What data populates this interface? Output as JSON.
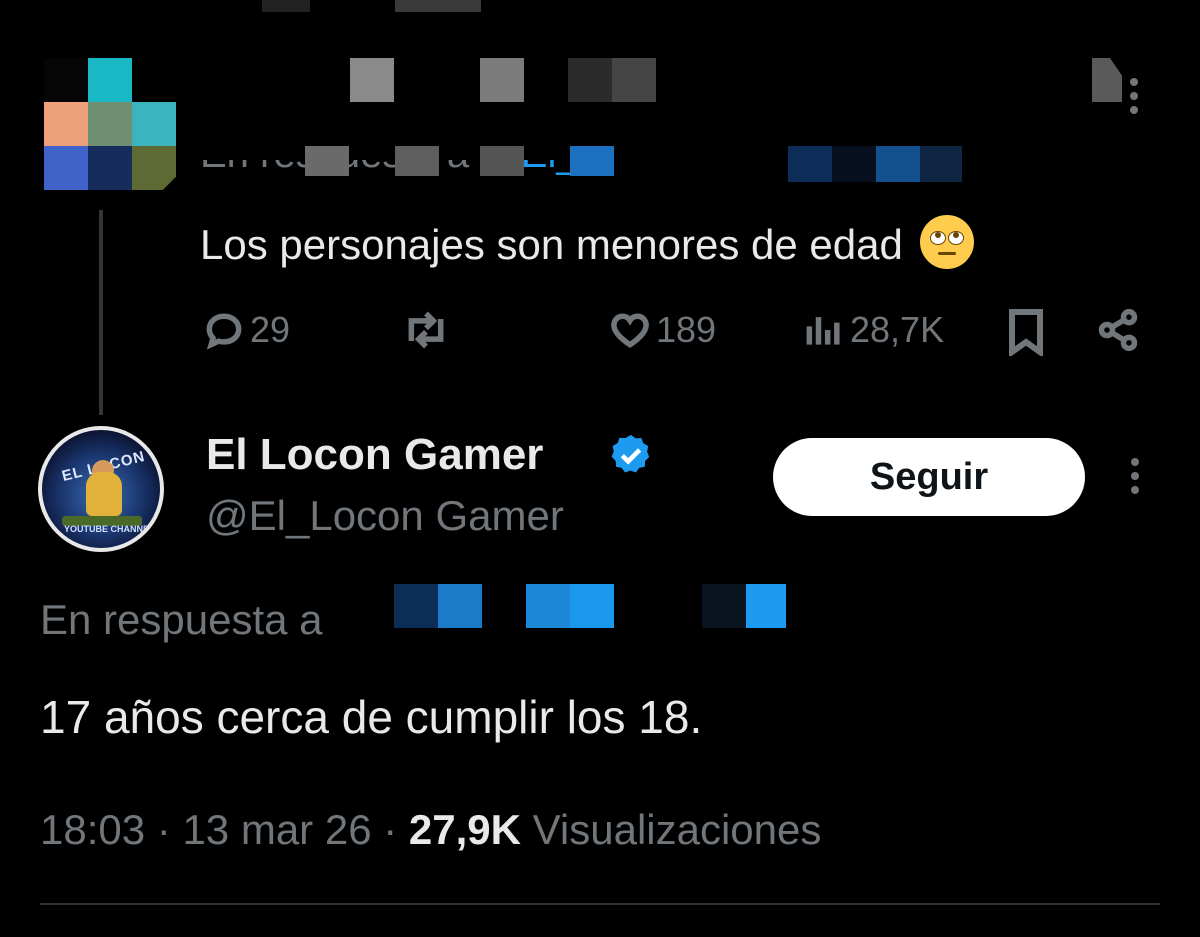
{
  "parent_tweet": {
    "reply_prefix": "En respuesta a",
    "reply_handle": "@El_",
    "text": "Los personajes son menores de edad",
    "emoji": "face-with-rolling-eyes",
    "stats": {
      "replies": "29",
      "reposts": "",
      "likes": "189",
      "views": "28,7K"
    }
  },
  "main_tweet": {
    "display_name": "El Locon Gamer",
    "handle": "@El_Locon Gamer",
    "avatar_text": "EL LOCON GAMER",
    "avatar_subtext": "YOUTUBE CHANNEL",
    "follow_label": "Seguir",
    "reply_prefix": "En respuesta a",
    "text": "17 años cerca de cumplir los 18.",
    "time": "18:03",
    "separator": "·",
    "date": "13 mar 26",
    "views_count": "27,9K",
    "views_label": "Visualizaciones"
  },
  "colors": {
    "background": "#000000",
    "text_primary": "#e7e9ea",
    "text_secondary": "#71767b",
    "accent": "#1d9bf0",
    "follow_button_bg": "#ffffff"
  }
}
